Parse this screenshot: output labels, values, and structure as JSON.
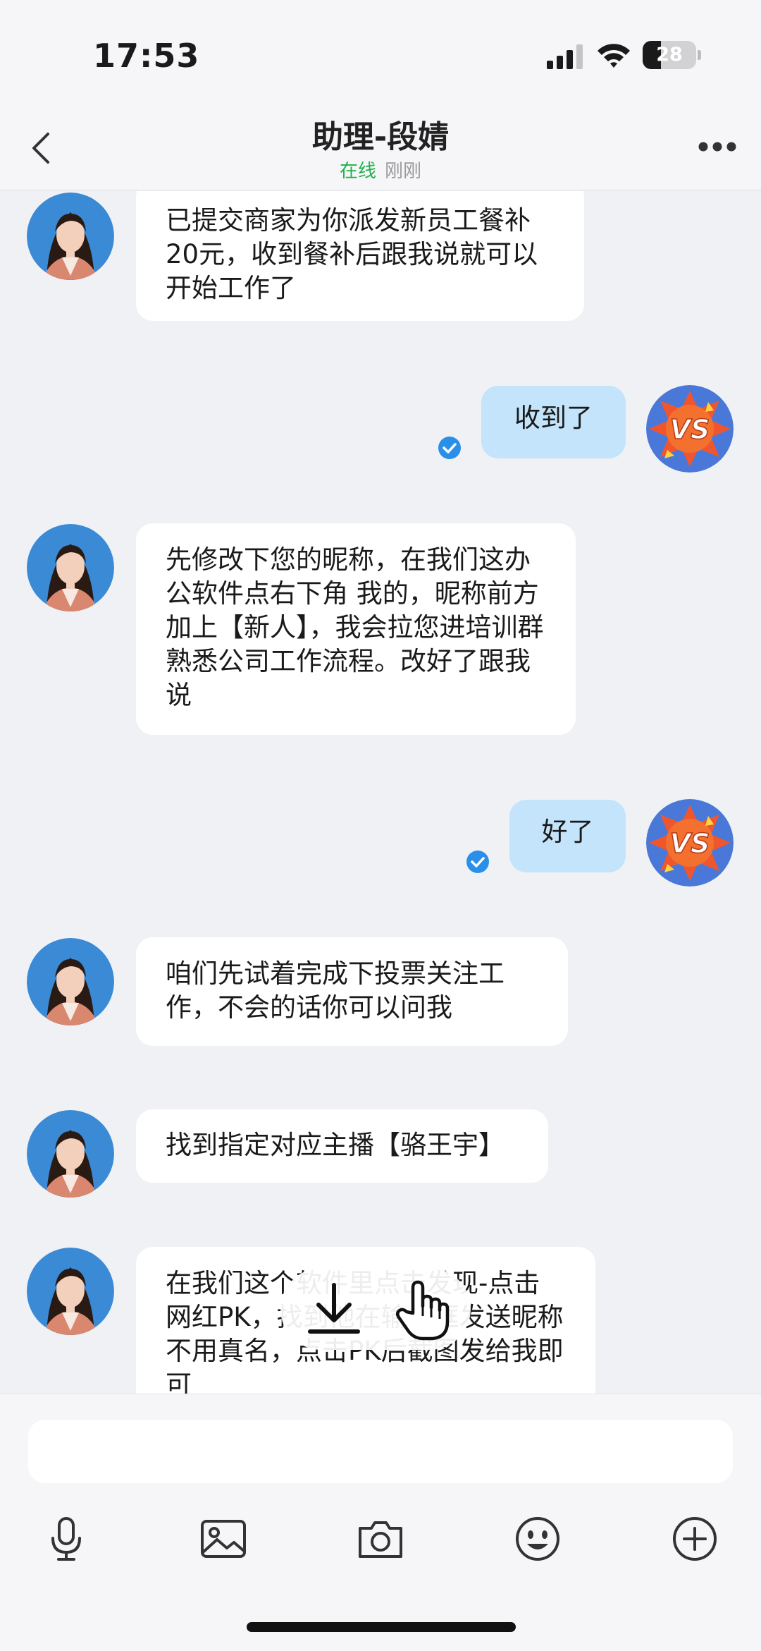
{
  "status_bar": {
    "time": "17:53",
    "battery": "28"
  },
  "header": {
    "title": "助理-段婧",
    "status": "在线",
    "last_seen": "刚刚"
  },
  "messages": [
    {
      "side": "in",
      "text": "已提交商家为你派发新员工餐补20元，收到餐补后跟我说就可以开始工作了"
    },
    {
      "side": "out",
      "text": "收到了",
      "read": true
    },
    {
      "side": "in",
      "text": "先修改下您的昵称，在我们这办公软件点右下角 我的，昵称前方加上【新人】，我会拉您进培训群熟悉公司工作流程。改好了跟我说"
    },
    {
      "side": "out",
      "text": "好了",
      "read": true
    },
    {
      "side": "in",
      "text": "咱们先试着完成下投票关注工作，不会的话你可以问我"
    },
    {
      "side": "in",
      "text": "找到指定对应主播【骆王宇】"
    },
    {
      "side": "in",
      "text": "在我们这个软件里点击发现-点击网红PK，找到他在输入框发送昵称不用真名，点击PK后截图发给我即可"
    }
  ],
  "input": {
    "value": "",
    "placeholder": ""
  },
  "toolbar": [
    "microphone-icon",
    "image-icon",
    "camera-icon",
    "emoji-icon",
    "add-icon"
  ],
  "colors": {
    "accent_online": "#21b14b",
    "outgoing_bubble": "#c3e4fb",
    "background": "#f0f1f5",
    "read_check": "#2a8fe8"
  }
}
